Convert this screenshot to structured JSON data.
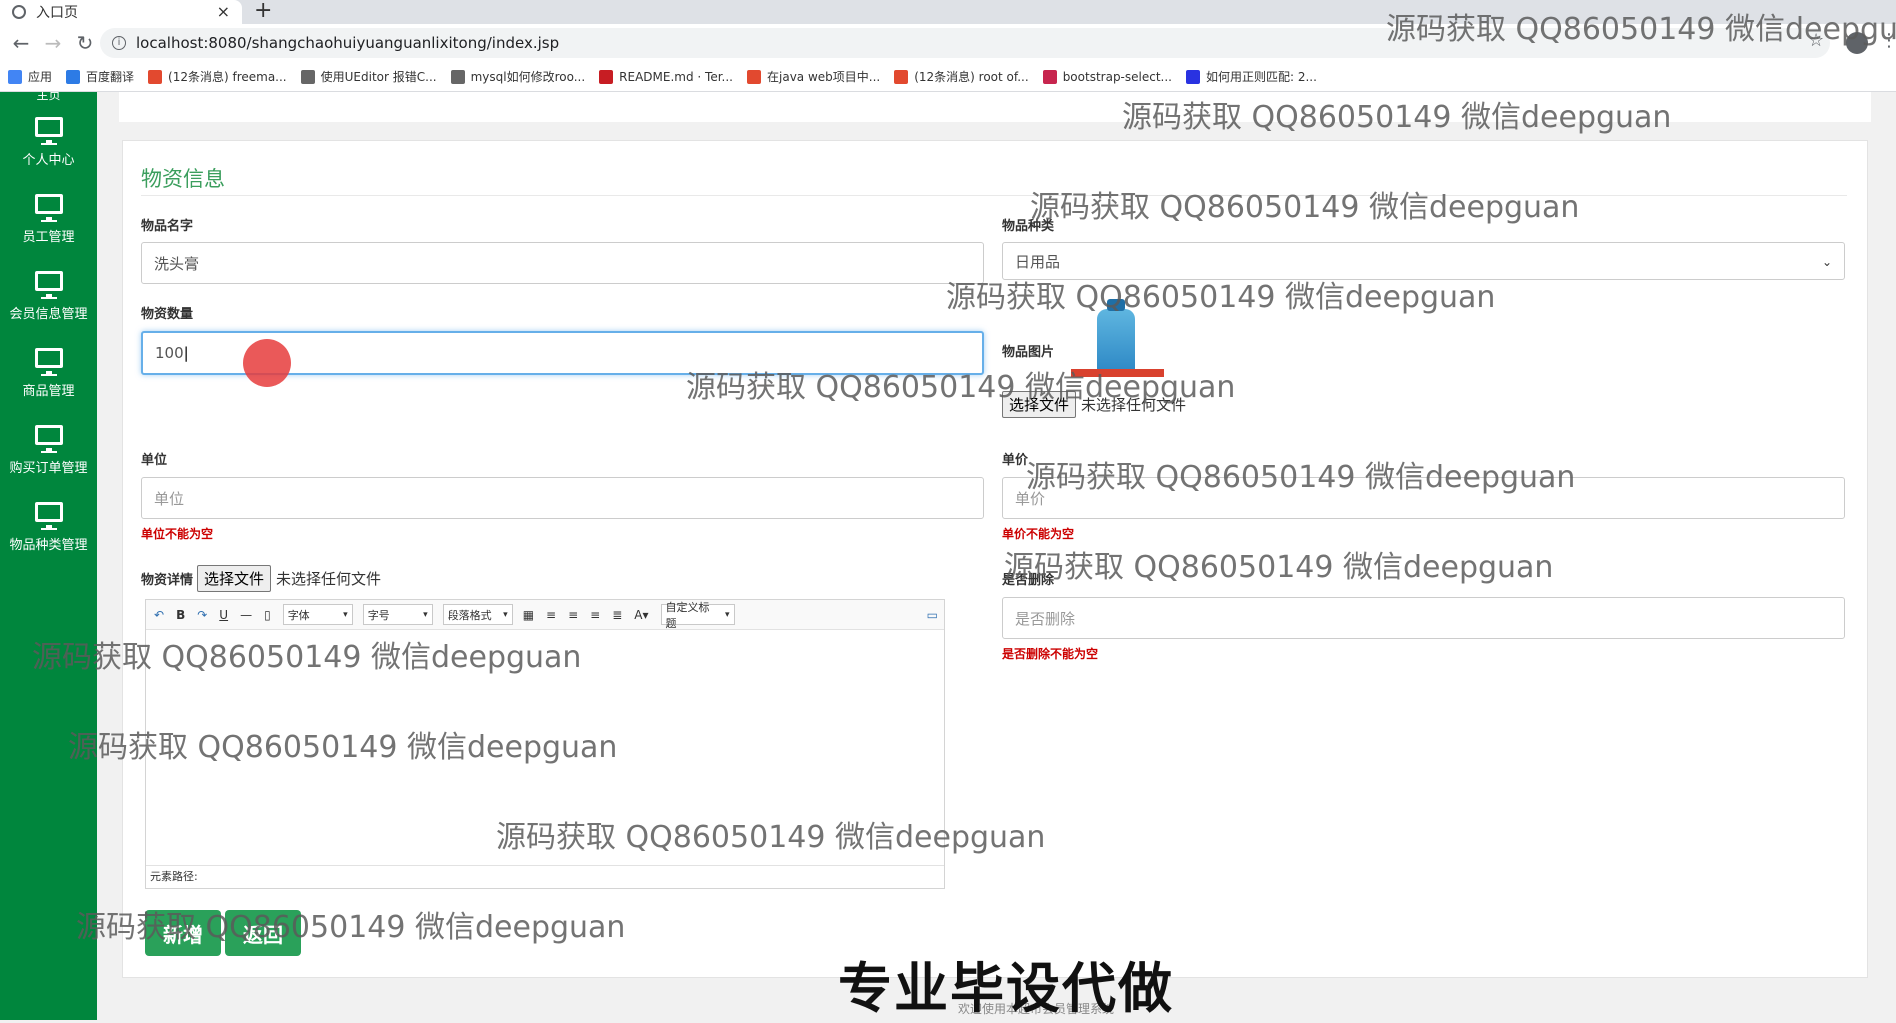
{
  "browser": {
    "tab_title": "入口页",
    "tab_close": "×",
    "new_tab": "+",
    "url": "localhost:8080/shangchaohuiyuanguanlixitong/index.jsp",
    "bookmarks": [
      {
        "label": "应用",
        "color": "#4285f4"
      },
      {
        "label": "百度翻译",
        "color": "#2d7be5"
      },
      {
        "label": "(12条消息) freema...",
        "color": "#e2492f"
      },
      {
        "label": "使用UEditor 报错C...",
        "color": "#666666"
      },
      {
        "label": "mysql如何修改roo...",
        "color": "#666666"
      },
      {
        "label": "README.md · Ter...",
        "color": "#c71d23"
      },
      {
        "label": "在java web项目中...",
        "color": "#e2492f"
      },
      {
        "label": "(12条消息) root of...",
        "color": "#e2492f"
      },
      {
        "label": "bootstrap-select...",
        "color": "#c7254e"
      },
      {
        "label": "如何用正则匹配: 2...",
        "color": "#2932e1"
      }
    ]
  },
  "sidebar": {
    "top_label": "主页",
    "items": [
      {
        "label": "个人中心",
        "icon": "monitor-icon"
      },
      {
        "label": "员工管理",
        "icon": "monitor-icon"
      },
      {
        "label": "会员信息管理",
        "icon": "monitor-icon"
      },
      {
        "label": "商品管理",
        "icon": "monitor-icon"
      },
      {
        "label": "购买订单管理",
        "icon": "monitor-icon"
      },
      {
        "label": "物品种类管理",
        "icon": "monitor-icon"
      }
    ]
  },
  "form": {
    "title": "物资信息",
    "name_label": "物品名字",
    "name_value": "洗头膏",
    "type_label": "物品种类",
    "type_value": "日用品",
    "qty_label": "物资数量",
    "qty_value": "100",
    "image_label": "物品图片",
    "image_file_button": "选择文件",
    "image_file_text": "未选择任何文件",
    "unit_label": "单位",
    "unit_placeholder": "单位",
    "unit_error": "单位不能为空",
    "price_label": "单价",
    "price_placeholder": "单价",
    "price_error": "单价不能为空",
    "detail_label": "物资详情",
    "detail_file_button": "选择文件",
    "detail_file_text": "未选择任何文件",
    "deleted_label": "是否删除",
    "deleted_placeholder": "是否删除",
    "deleted_error": "是否删除不能为空",
    "editor": {
      "font_select": "字体",
      "size_select": "字号",
      "paragraph_select": "段落格式",
      "custom_title_select": "自定义标题",
      "bold": "B",
      "underline": "U",
      "font_color": "A",
      "path_label": "元素路径:"
    },
    "add_button": "新增",
    "back_button": "返回"
  },
  "overlays": {
    "watermark": "源码获取 QQ86050149 微信deepguan",
    "caption": "专业毕设代做",
    "footnote": "欢迎使用本超市会员管理系统"
  },
  "colors": {
    "sidebar_bg": "#00863d",
    "title_green": "#3b9e5d",
    "button_green": "#2aa15a",
    "error_red": "#cc0000"
  }
}
